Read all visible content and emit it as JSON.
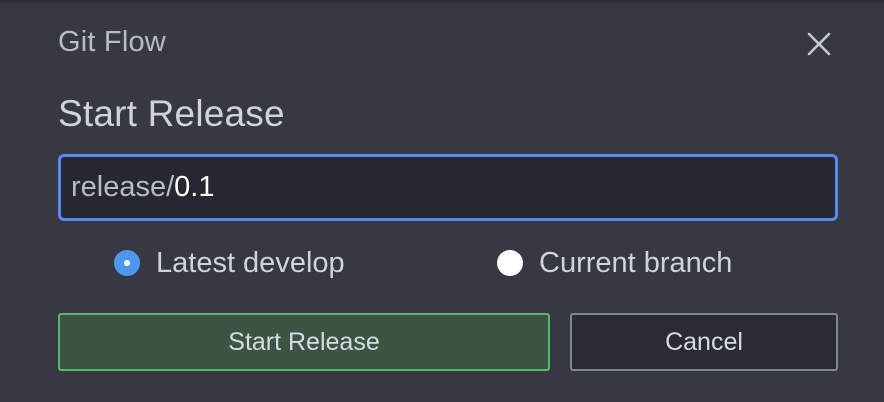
{
  "dialog": {
    "title": "Git Flow",
    "heading": "Start Release",
    "close_icon": "close-icon"
  },
  "branch_input": {
    "prefix": "release/",
    "value": "0.1"
  },
  "base_options": [
    {
      "label": "Latest develop",
      "checked": true
    },
    {
      "label": "Current branch",
      "checked": false
    }
  ],
  "buttons": {
    "start_label": "Start Release",
    "cancel_label": "Cancel"
  },
  "colors": {
    "background": "#363944",
    "input_focus_border": "#568af2",
    "radio_checked": "#4d97ef",
    "start_button_border": "#5bb866",
    "start_button_bg": "#3b5444"
  }
}
